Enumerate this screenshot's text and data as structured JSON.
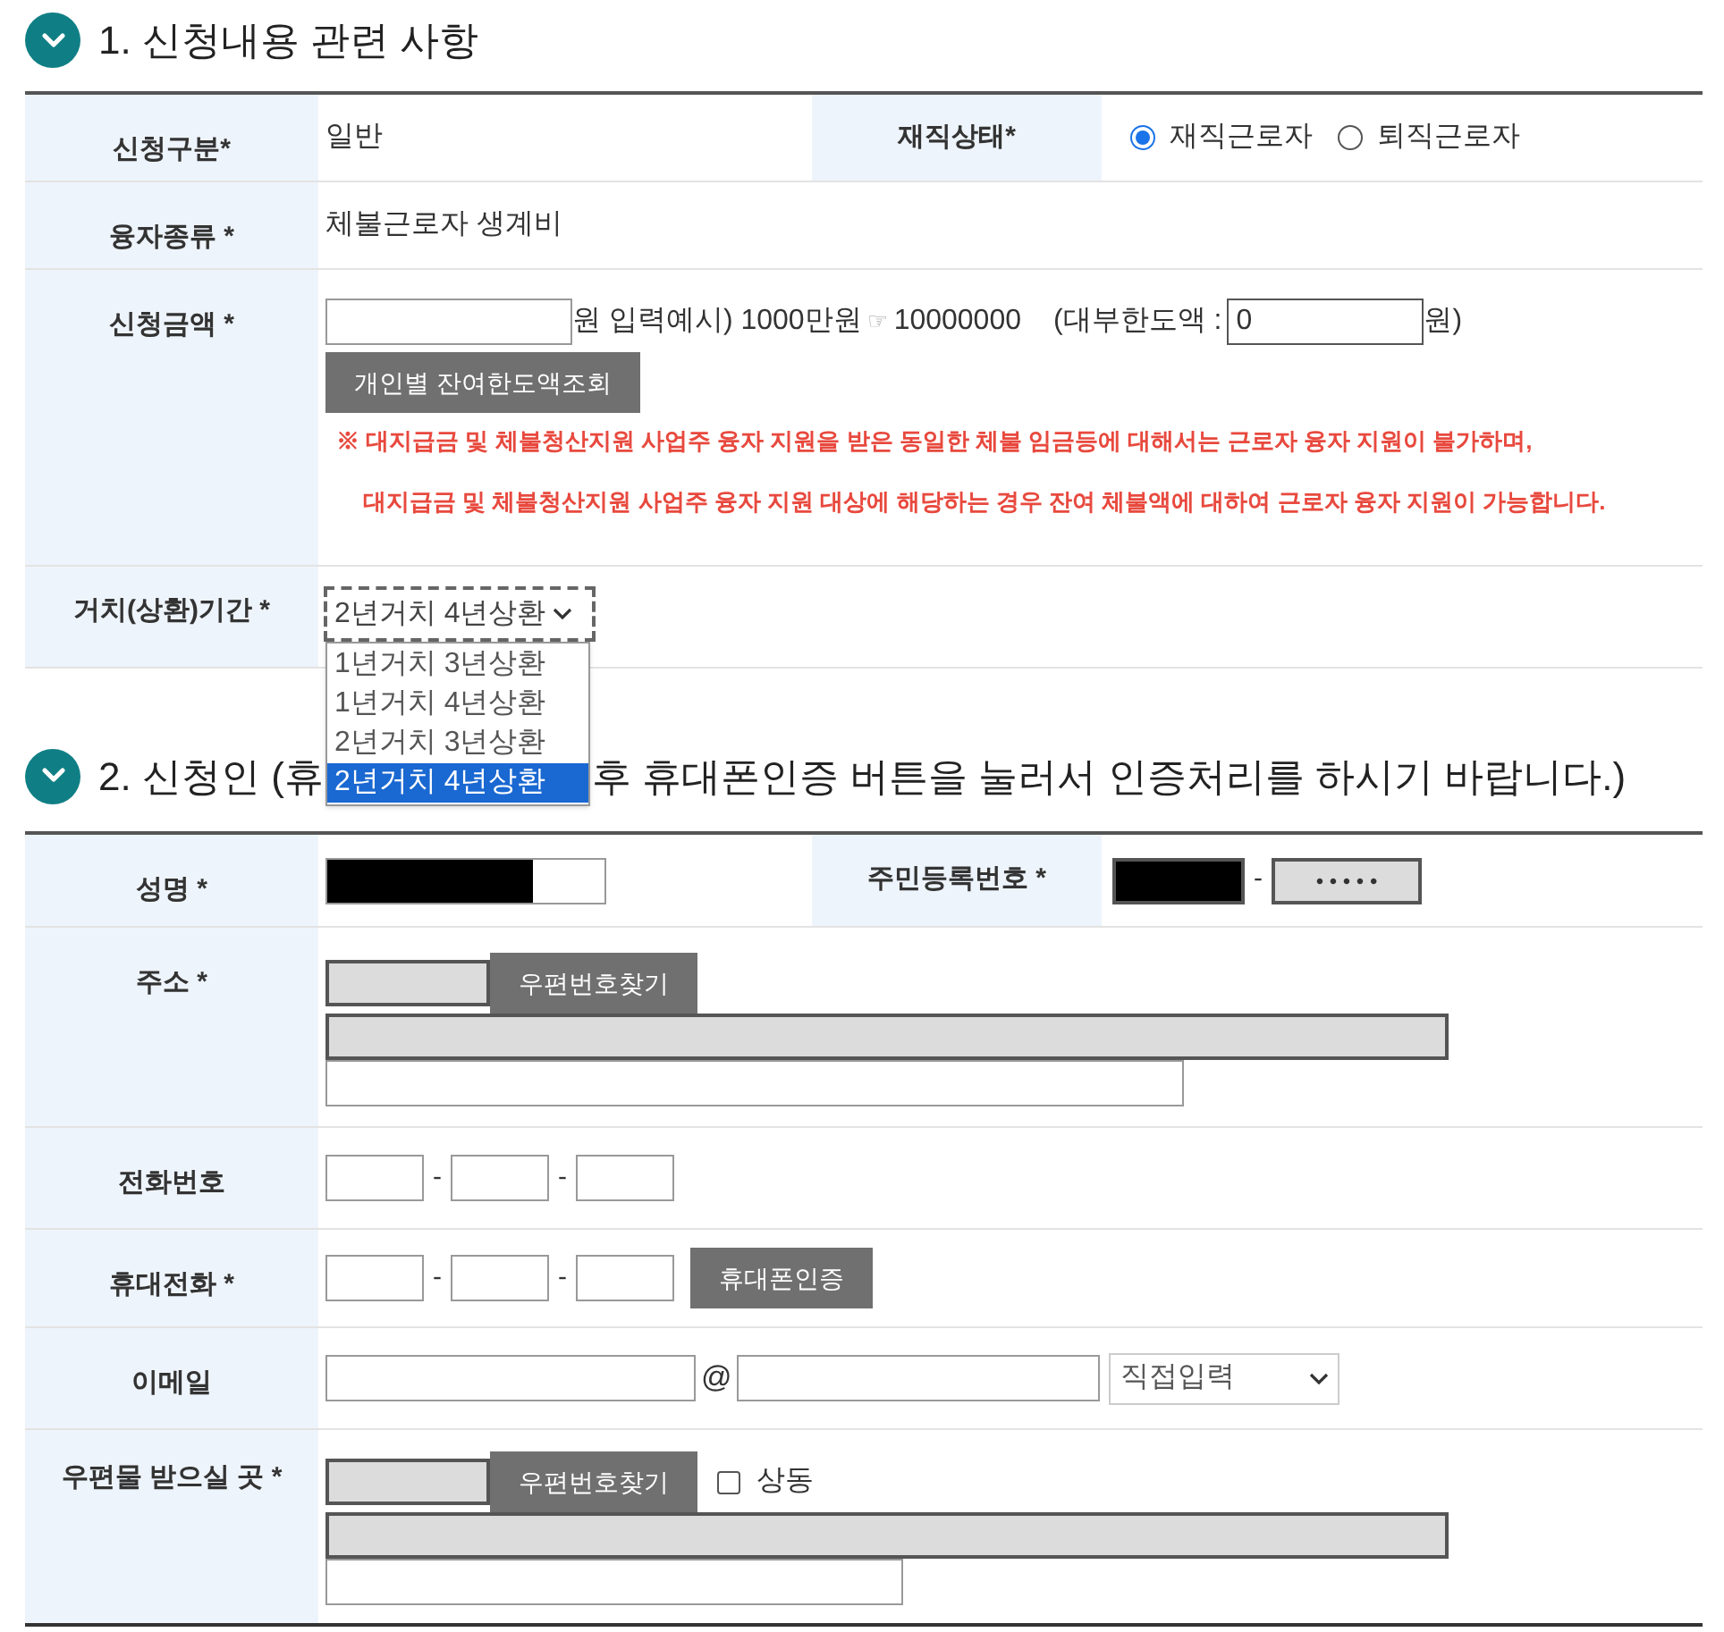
{
  "section1": {
    "title": "1. 신청내용 관련 사항",
    "application_type": {
      "label": "신청구분*",
      "value": "일반"
    },
    "employment_status": {
      "label": "재직상태*",
      "options": [
        {
          "label": "재직근로자",
          "selected": true
        },
        {
          "label": "퇴직근로자",
          "selected": false
        }
      ]
    },
    "loan_type": {
      "label": "융자종류 *",
      "value": "체불근로자 생계비"
    },
    "amount": {
      "label": "신청금액 *",
      "unit": "원 입력예시) 1000만원",
      "pointer": "☞",
      "example": "10000000",
      "limit_label": "(대부한도액 :",
      "limit_value": "0",
      "limit_unit": "원)",
      "button": "개인별 잔여한도액조회",
      "notes": [
        "※ 대지급금 및 체불청산지원 사업주 융자 지원을 받은 동일한 체불 임금등에 대해서는 근로자 융자 지원이 불가하며,",
        "대지급금 및 체불청산지원 사업주 융자 지원 대상에 해당하는 경우 잔여 체불액에 대하여 근로자 융자 지원이 가능합니다."
      ]
    },
    "period": {
      "label": "거치(상환)기간 *",
      "value": "2년거치 4년상환",
      "expanded": true,
      "options": [
        {
          "label": "1년거치 3년상환",
          "selected": false
        },
        {
          "label": "1년거치 4년상환",
          "selected": false
        },
        {
          "label": "2년거치 3년상환",
          "selected": false
        },
        {
          "label": "2년거치 4년상환",
          "selected": true
        }
      ]
    }
  },
  "section2": {
    "title_parts": [
      "2. 신청인 (휴",
      "후 휴대폰인증 버튼을 눌러서 인증처리를 하시기 바랍니다.)"
    ],
    "name": {
      "label": "성명 *"
    },
    "ssn": {
      "label": "주민등록번호 *",
      "separator": "-",
      "masked": "• • • • •"
    },
    "address": {
      "label": "주소 *",
      "button": "우편번호찾기"
    },
    "phone": {
      "label": "전화번호",
      "separators": [
        "-",
        "-"
      ]
    },
    "mobile": {
      "label": "휴대전화 *",
      "separators": [
        "-",
        "-"
      ],
      "button": "휴대폰인증"
    },
    "email": {
      "label": "이메일",
      "at": "@",
      "domain_select": "직접입력"
    },
    "mailing": {
      "label": "우편물 받으실 곳 *",
      "button": "우편번호찾기",
      "same_checkbox": {
        "label": "상동",
        "checked": false
      }
    }
  }
}
